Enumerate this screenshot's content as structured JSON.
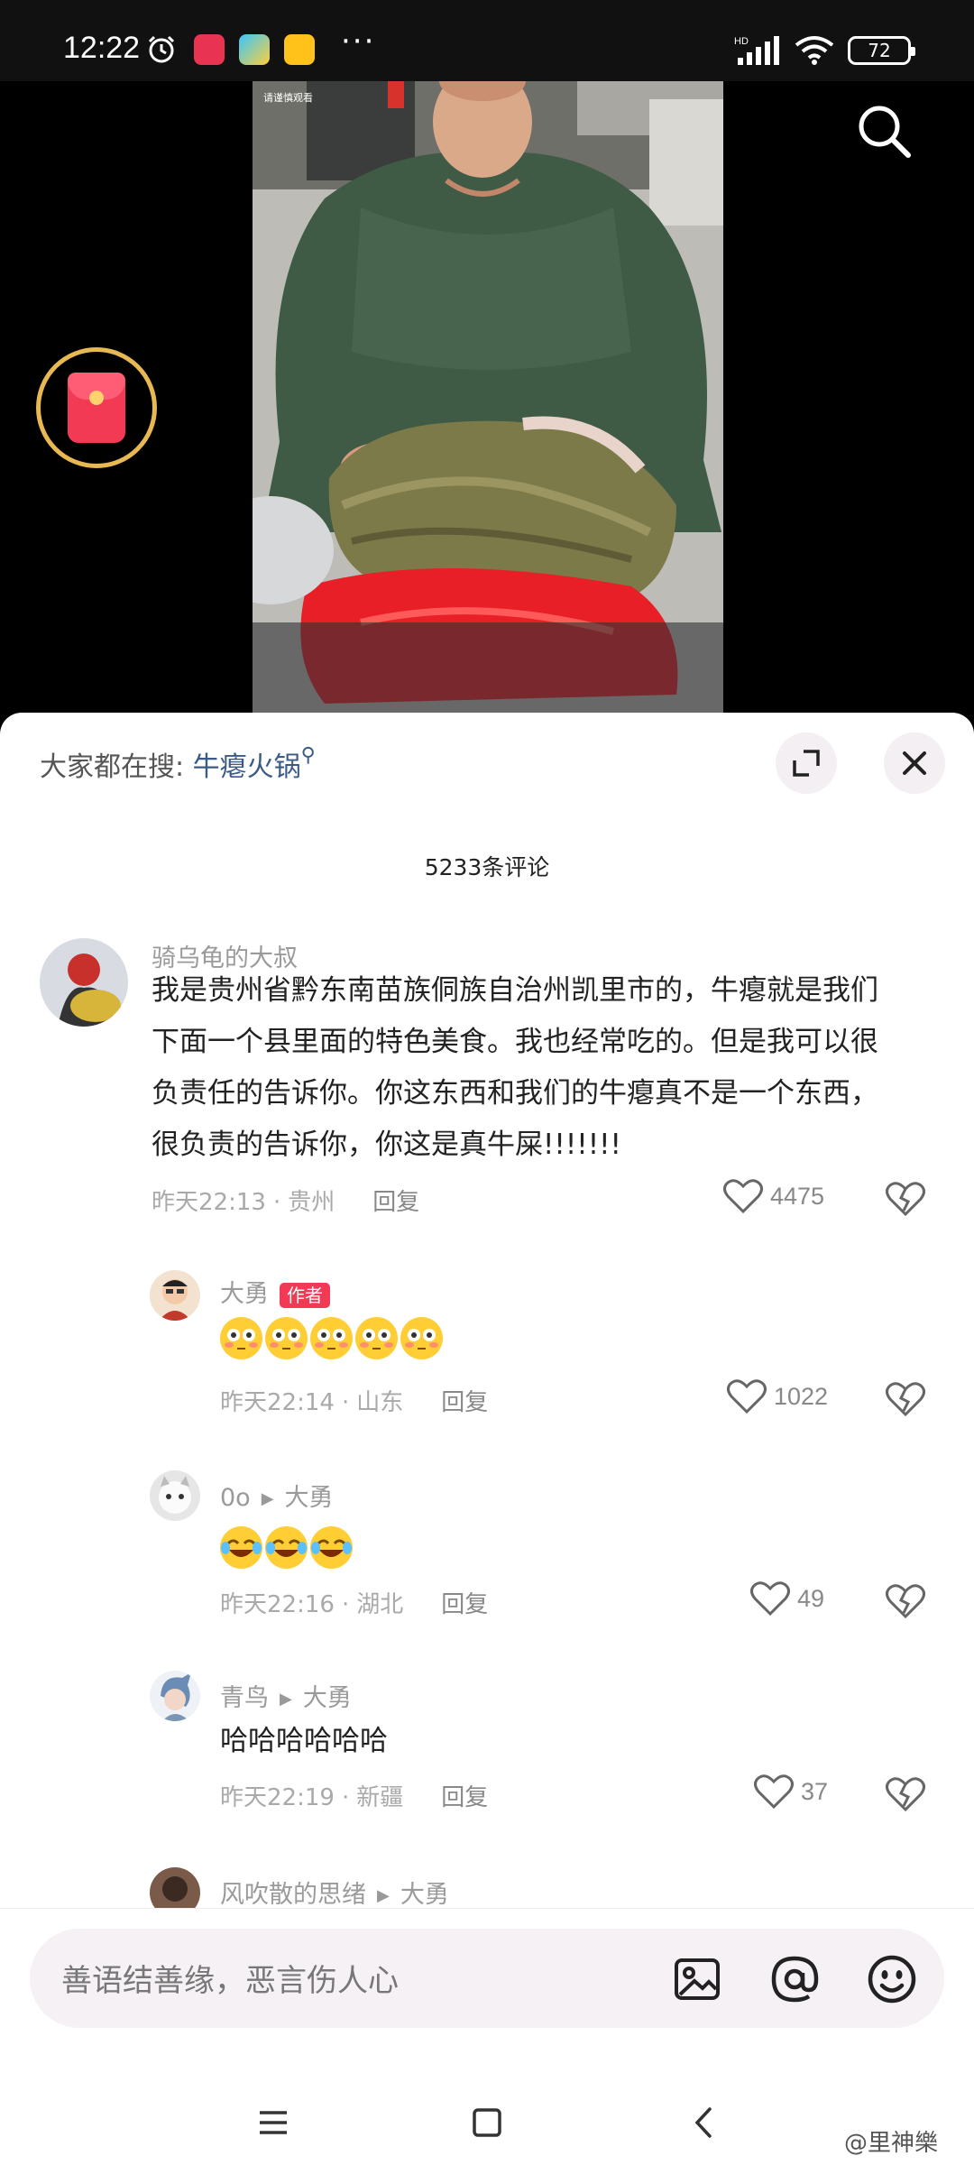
{
  "status_bar": {
    "time": "12:22",
    "dots": "···",
    "network": "HD",
    "battery": "72"
  },
  "sheet": {
    "search_prefix": "大家都在搜:",
    "search_keyword": "牛瘪火锅",
    "title": "5233条评论"
  },
  "comments": [
    {
      "user": "骑乌龟的大叔",
      "text_lines": [
        "我是贵州省黔东南苗族侗族自治州凯里市的，牛瘪就是我们",
        "下面一个县里面的特色美食。我也经常吃的。但是我可以很",
        "负责任的告诉你。你这东西和我们的牛瘪真不是一个东西，",
        "很负责的告诉你，你这是真牛屎!!!!!!!"
      ],
      "time": "昨天22:13",
      "location": "贵州",
      "reply": "回复",
      "likes": "4475"
    },
    {
      "user": "大勇",
      "badge": "作者",
      "emoji": [
        "😳",
        "😳",
        "😳",
        "😳",
        "😳"
      ],
      "time": "昨天22:14",
      "location": "山东",
      "reply": "回复",
      "likes": "1022"
    },
    {
      "user": "0o",
      "reply_to": "大勇",
      "emoji": [
        "😂",
        "😂",
        "😂"
      ],
      "time": "昨天22:16",
      "location": "湖北",
      "reply": "回复",
      "likes": "49"
    },
    {
      "user": "青鸟",
      "reply_to": "大勇",
      "text": "哈哈哈哈哈哈",
      "time": "昨天22:19",
      "location": "新疆",
      "reply": "回复",
      "likes": "37"
    },
    {
      "user": "风吹散的思绪",
      "reply_to": "大勇"
    }
  ],
  "input": {
    "placeholder": "善语结善缘，恶言伤人心"
  },
  "watermark": "@里神樂",
  "icons": {
    "status": [
      "alarm-icon",
      "app-icon",
      "video-app-icon",
      "game-app-icon",
      "signal-icon",
      "wifi-icon",
      "battery-icon"
    ],
    "video": [
      "search-icon",
      "red-packet-icon"
    ],
    "sheet": [
      "expand-icon",
      "close-icon",
      "heart-icon",
      "dislike-icon"
    ],
    "input": [
      "image-icon",
      "at-icon",
      "emoji-icon"
    ],
    "nav": [
      "menu-icon",
      "home-icon",
      "back-icon"
    ]
  },
  "colors": {
    "accent_red": "#f23a55",
    "link_blue": "#3a5a88",
    "ring_gold": "#e8b952"
  }
}
